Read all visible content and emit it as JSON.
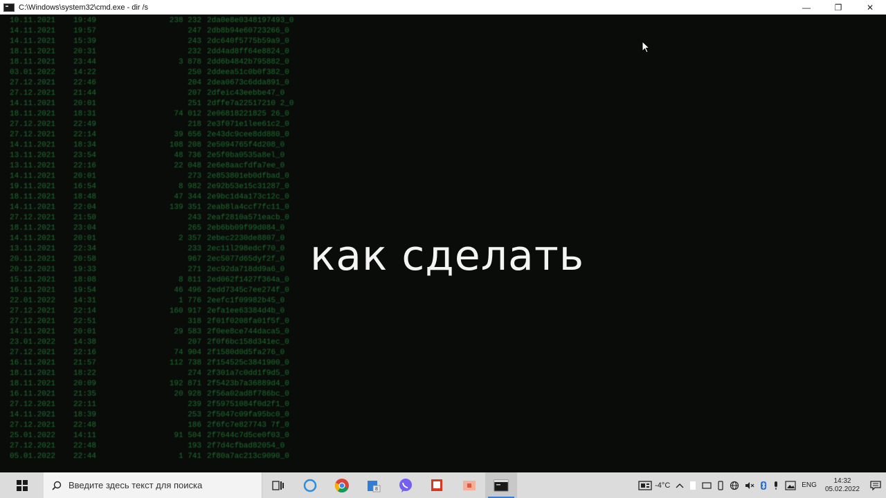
{
  "window": {
    "title": "C:\\Windows\\system32\\cmd.exe - dir /s",
    "minimize": "—",
    "restore": "❐",
    "close": "✕"
  },
  "caption": "как сделать",
  "console_rows": [
    {
      "date": "10.11.2021",
      "time": "19:49",
      "size": "238 232",
      "name": "2da0e8e0348197493_0"
    },
    {
      "date": "14.11.2021",
      "time": "19:57",
      "size": "247",
      "name": "2db8b94e60723266_0"
    },
    {
      "date": "14.11.2021",
      "time": "15:39",
      "size": "243",
      "name": "2dc640f5775b59a9_0"
    },
    {
      "date": "18.11.2021",
      "time": "20:31",
      "size": "232",
      "name": "2dd4ad8ff64e8824_0"
    },
    {
      "date": "18.11.2021",
      "time": "23:44",
      "size": "3 878",
      "name": "2dd6b4842b795882_0"
    },
    {
      "date": "03.01.2022",
      "time": "14:22",
      "size": "250",
      "name": "2ddeea51c0b0f382_0"
    },
    {
      "date": "27.12.2021",
      "time": "22:46",
      "size": "204",
      "name": "2dea0673c6dda891_0"
    },
    {
      "date": "27.12.2021",
      "time": "21:44",
      "size": "207",
      "name": "2dfeic43eebbe47_0"
    },
    {
      "date": "14.11.2021",
      "time": "20:01",
      "size": "251",
      "name": "2dffe7a22517210 2_0"
    },
    {
      "date": "18.11.2021",
      "time": "18:31",
      "size": "74 012",
      "name": "2e06818221825 26_0"
    },
    {
      "date": "27.12.2021",
      "time": "22:49",
      "size": "218",
      "name": "2e3f071e1lee61c2_0"
    },
    {
      "date": "27.12.2021",
      "time": "22:14",
      "size": "39 656",
      "name": "2e43dc9cee8dd880_0"
    },
    {
      "date": "14.11.2021",
      "time": "18:34",
      "size": "108 208",
      "name": "2e5094765f4d208_0"
    },
    {
      "date": "13.11.2021",
      "time": "23:54",
      "size": "48 736",
      "name": "2e5f0ba0535a8el_0"
    },
    {
      "date": "13.11.2021",
      "time": "22:16",
      "size": "22 048",
      "name": "2e6e8aacfdfa7ee_0"
    },
    {
      "date": "14.11.2021",
      "time": "20:01",
      "size": "273",
      "name": "2e853801eb0dfbad_0"
    },
    {
      "date": "19.11.2021",
      "time": "16:54",
      "size": "8 982",
      "name": "2e92b53e15c31287_0"
    },
    {
      "date": "18.11.2021",
      "time": "18:48",
      "size": "47 344",
      "name": "2e9bc1d4a173c12c_0"
    },
    {
      "date": "14.11.2021",
      "time": "22:04",
      "size": "139 351",
      "name": "2eab8la4ccf7fc11_0"
    },
    {
      "date": "27.12.2021",
      "time": "21:50",
      "size": "243",
      "name": "2eaf2810a571eacb_0"
    },
    {
      "date": "18.11.2021",
      "time": "23:04",
      "size": "265",
      "name": "2eb6bb09f99d084_0"
    },
    {
      "date": "14.11.2021",
      "time": "20:01",
      "size": "2 357",
      "name": "2ebec2230de8807_0"
    },
    {
      "date": "13.11.2021",
      "time": "22:34",
      "size": "233",
      "name": "2ec11l298edcf70_0"
    },
    {
      "date": "20.11.2021",
      "time": "20:58",
      "size": "967",
      "name": "2ec5077d65dyf2f_0"
    },
    {
      "date": "20.12.2021",
      "time": "19:33",
      "size": "271",
      "name": "2ec92da718dd9a6_0"
    },
    {
      "date": "15.11.2021",
      "time": "18:08",
      "size": "8 811",
      "name": "2ed062f1427f364a_0"
    },
    {
      "date": "16.11.2021",
      "time": "19:54",
      "size": "46 496",
      "name": "2edd7345c7ee274f_0"
    },
    {
      "date": "22.01.2022",
      "time": "14:31",
      "size": "1 776",
      "name": "2eefc1f09982b45_0"
    },
    {
      "date": "27.12.2021",
      "time": "22:14",
      "size": "160 917",
      "name": "2efa1ee63384d4b_0"
    },
    {
      "date": "27.12.2021",
      "time": "22:51",
      "size": "318",
      "name": "2f01f0208fa01f5f_0"
    },
    {
      "date": "14.11.2021",
      "time": "20:01",
      "size": "29 583",
      "name": "2f0ee8ce744daca5_0"
    },
    {
      "date": "23.01.2022",
      "time": "14:38",
      "size": "207",
      "name": "2f0f6bc158d341ec_0"
    },
    {
      "date": "27.12.2021",
      "time": "22:16",
      "size": "74 904",
      "name": "2f1580d0d5fa276_0"
    },
    {
      "date": "16.11.2021",
      "time": "21:57",
      "size": "112 738",
      "name": "2f154525c3841900_0"
    },
    {
      "date": "18.11.2021",
      "time": "18:22",
      "size": "274",
      "name": "2f301a7c0dd1f9d5_0"
    },
    {
      "date": "18.11.2021",
      "time": "20:09",
      "size": "192 871",
      "name": "2f5423b7a36889d4_0"
    },
    {
      "date": "16.11.2021",
      "time": "21:35",
      "size": "20 928",
      "name": "2f56a02ad8f786bc_0"
    },
    {
      "date": "27.12.2021",
      "time": "22:11",
      "size": "239",
      "name": "2f59751084f0d2f1_0"
    },
    {
      "date": "14.11.2021",
      "time": "18:39",
      "size": "253",
      "name": "2f5047c09fa95bc0_0"
    },
    {
      "date": "27.12.2021",
      "time": "22:48",
      "size": "186",
      "name": "2f6fc7e827743 7f_0"
    },
    {
      "date": "25.01.2022",
      "time": "14:11",
      "size": "91 504",
      "name": "2f7644c7d5ce0f03_0"
    },
    {
      "date": "27.12.2021",
      "time": "22:48",
      "size": "193",
      "name": "2f7d4cfbad82054_0"
    },
    {
      "date": "05.01.2022",
      "time": "22:44",
      "size": "1 741",
      "name": "2f80a7ac213c9090_0"
    }
  ],
  "taskbar": {
    "search_placeholder": "Введите здесь текст для поиска",
    "temperature": "-4°C",
    "language": "ENG",
    "time": "14:32",
    "date": "05.02.2022"
  },
  "colors": {
    "console_text": "#29c04a",
    "console_bg": "#0a0c0a",
    "taskbar_bg": "#dcdcdc"
  }
}
